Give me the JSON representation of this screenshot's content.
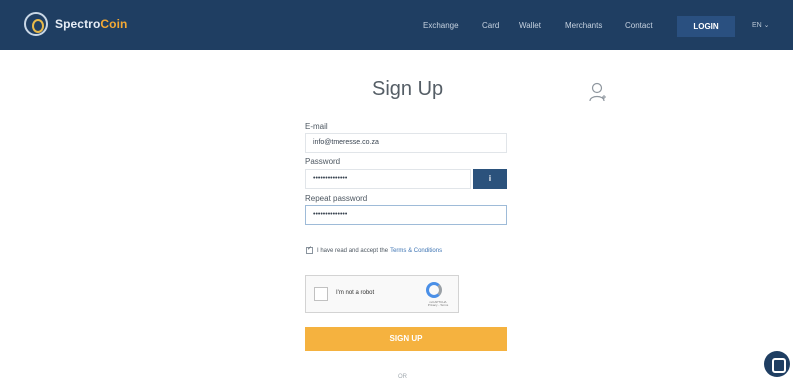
{
  "header": {
    "brand_first": "Spectro",
    "brand_second": "Coin",
    "nav": [
      "Exchange",
      "Card",
      "Wallet",
      "Merchants",
      "Contact"
    ],
    "login_label": "LOGIN",
    "language": "EN ⌄"
  },
  "form": {
    "title": "Sign Up",
    "email_label": "E-mail",
    "email_value": "info@tmeresse.co.za",
    "password_label": "Password",
    "password_value": "••••••••••••••",
    "info_label": "i",
    "repeat_label": "Repeat password",
    "repeat_value": "••••••••••••••",
    "terms_text": "I have read and accept the",
    "terms_link": "Terms & Conditions",
    "captcha_label": "I'm not a robot",
    "captcha_brand": "reCAPTCHA",
    "captcha_sub": "Privacy - Terms",
    "submit_label": "SIGN UP",
    "or_text": "OR"
  },
  "colors": {
    "navbar": "#1f3e62",
    "accent": "#f5b23f",
    "button_blue": "#2b527c"
  }
}
